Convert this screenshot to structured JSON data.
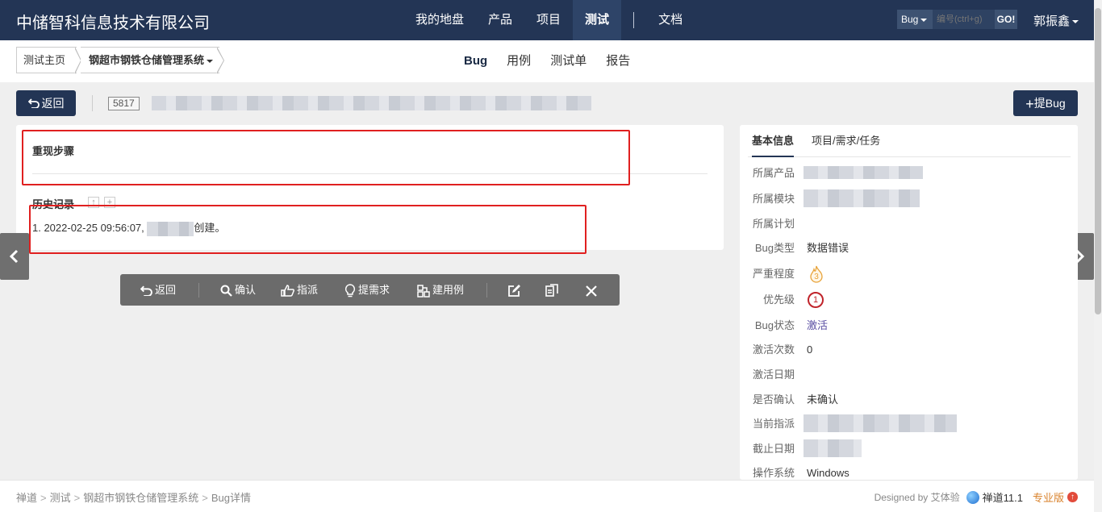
{
  "header": {
    "brand": "中储智科信息技术有限公司",
    "nav": [
      {
        "label": "我的地盘",
        "active": false
      },
      {
        "label": "产品",
        "active": false
      },
      {
        "label": "项目",
        "active": false
      },
      {
        "label": "测试",
        "active": true
      },
      {
        "label": "文档",
        "active": false
      }
    ],
    "search": {
      "type_label": "Bug",
      "placeholder": "编号(ctrl+g)",
      "go_label": "GO!"
    },
    "user": "郭振鑫"
  },
  "subheader": {
    "breadcrumb_home": "测试主页",
    "breadcrumb_product": "钢超市钢铁仓储管理系统",
    "tabs": [
      {
        "label": "Bug",
        "active": true
      },
      {
        "label": "用例",
        "active": false
      },
      {
        "label": "测试单",
        "active": false
      },
      {
        "label": "报告",
        "active": false
      }
    ]
  },
  "titlebar": {
    "back_label": "返回",
    "bug_id": "5817",
    "add_bug_label": "提Bug"
  },
  "main": {
    "steps_title": "重现步骤",
    "history_title": "历史记录",
    "history_prefix": "1. 2022-02-25 09:56:07, ",
    "history_suffix": "创建。"
  },
  "actions": {
    "back": "返回",
    "confirm": "确认",
    "assign": "指派",
    "story": "提需求",
    "create_case": "建用例"
  },
  "info": {
    "tabs": [
      "基本信息",
      "项目/需求/任务"
    ],
    "labels": {
      "product": "所属产品",
      "module": "所属模块",
      "plan": "所属计划",
      "type": "Bug类型",
      "severity": "严重程度",
      "priority": "优先级",
      "status": "Bug状态",
      "activated_count": "激活次数",
      "activated_date": "激活日期",
      "confirmed": "是否确认",
      "assigned_to": "当前指派",
      "deadline": "截止日期",
      "os": "操作系统"
    },
    "values": {
      "type": "数据错误",
      "severity": "3",
      "priority": "1",
      "status": "激活",
      "activated_count": "0",
      "confirmed": "未确认",
      "os": "Windows"
    }
  },
  "footer": {
    "crumbs": [
      "禅道",
      "测试",
      "钢超市钢铁仓储管理系统",
      "Bug详情"
    ],
    "designed_by": "Designed by 艾体验",
    "version": "禅道11.1",
    "edition": "专业版"
  },
  "colors": {
    "header_bg": "#233555",
    "highlight_red": "#e02020",
    "action_bar": "#6b6b6b"
  }
}
